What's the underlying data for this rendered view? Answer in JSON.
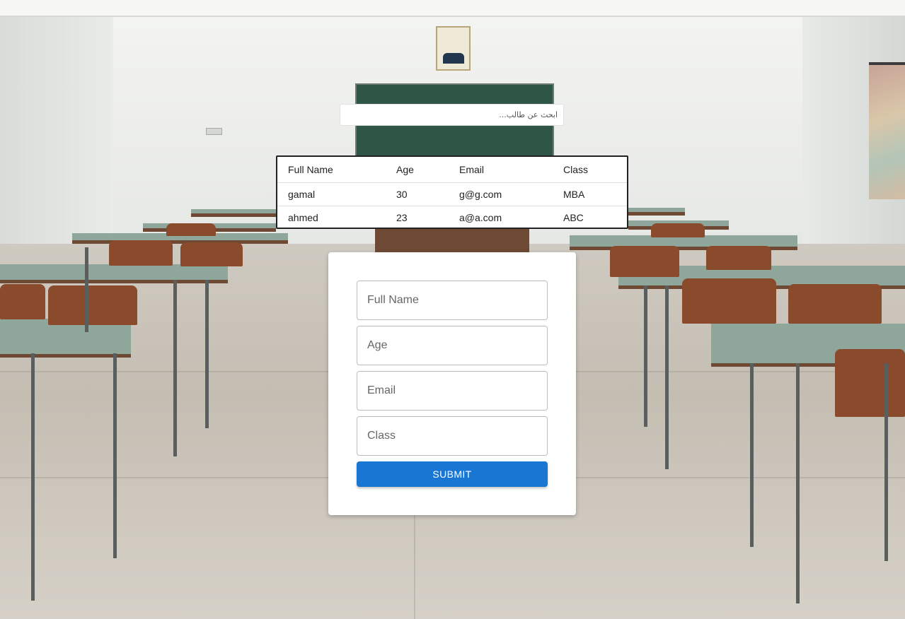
{
  "search": {
    "placeholder": "ابحث عن طالب..."
  },
  "table": {
    "headers": [
      "Full Name",
      "Age",
      "Email",
      "Class"
    ],
    "rows": [
      [
        "gamal",
        "30",
        "g@g.com",
        "MBA"
      ],
      [
        "ahmed",
        "23",
        "a@a.com",
        "ABC"
      ]
    ]
  },
  "form": {
    "full_name_placeholder": "Full Name",
    "age_placeholder": "Age",
    "email_placeholder": "Email",
    "class_placeholder": "Class",
    "submit_label": "SUBMIT"
  },
  "colors": {
    "accent": "#1976d2"
  }
}
